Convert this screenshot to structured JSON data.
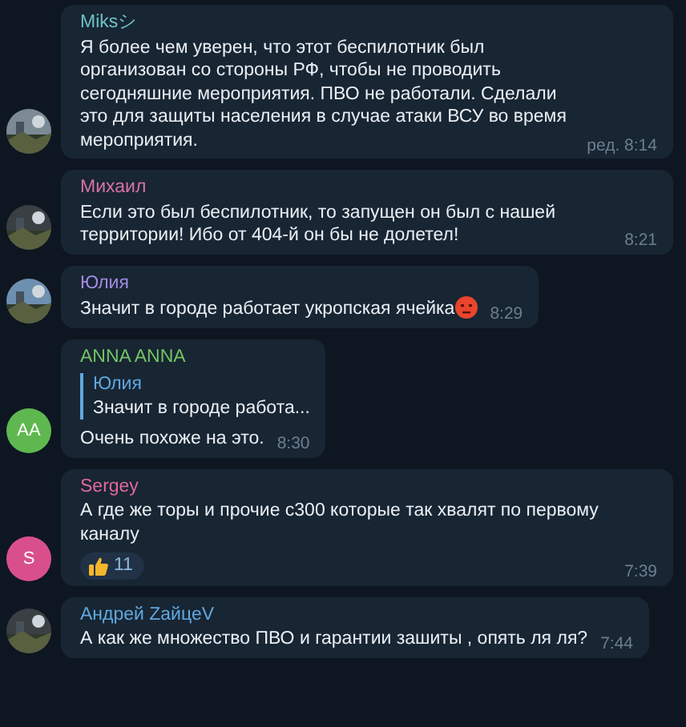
{
  "messages": [
    {
      "author": "Miksシ",
      "color": "#6cc4c4",
      "text": "Я более чем уверен, что этот беспилотник был организован со стороны РФ, чтобы не проводить сегодняшние мероприятия. ПВО не работали. Сделали это для защиты населения в случае атаки ВСУ во время мероприятия.",
      "time": "ред. 8:14"
    },
    {
      "author": "Михаил",
      "color": "#d672a8",
      "text": "Если это был беспилотник, то запущен он был с нашей территории! Ибо от 404-й он бы не долетел!",
      "time": "8:21"
    },
    {
      "author": "Юлия",
      "color": "#a08ae0",
      "text": "Значит в городе работает укропская ячейка",
      "emoji": true,
      "time": "8:29"
    },
    {
      "author": "ANNA ANNA",
      "color": "#73c464",
      "avatar": {
        "kind": "initials",
        "initials": "AA",
        "color": "#5fb84f"
      },
      "reply": {
        "author": "Юлия",
        "text": "Значит в городе работа..."
      },
      "text": "Очень похоже на это.",
      "time": "8:30"
    },
    {
      "author": "Sergey",
      "color": "#e0689a",
      "avatar": {
        "kind": "initials",
        "initials": "S",
        "color": "#d94f8c"
      },
      "text": "А где же торы и прочие с300 которые так хвалят по первому каналу",
      "reaction": {
        "count": "11"
      },
      "time": "7:39"
    },
    {
      "author": "Андрей ZайцеV",
      "color": "#5fa8de",
      "text": "А как же множество ПВО и гарантии зашиты , опять ля ля?",
      "time": "7:44"
    }
  ]
}
